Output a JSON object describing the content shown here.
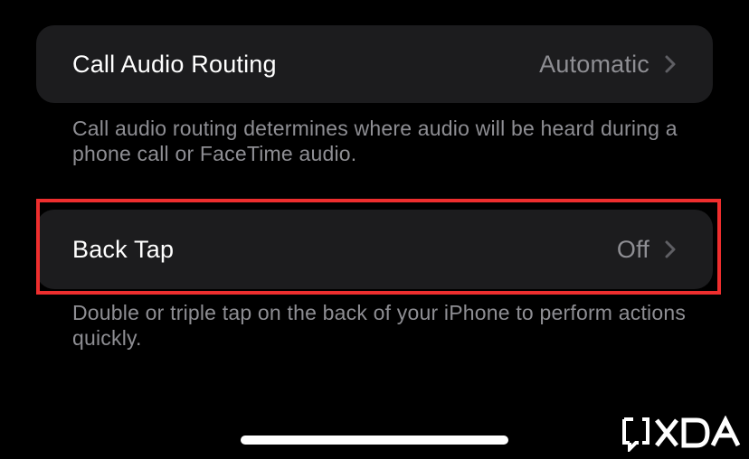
{
  "settings": {
    "call_audio_routing": {
      "label": "Call Audio Routing",
      "value": "Automatic",
      "footer": "Call audio routing determines where audio will be heard during a phone call or FaceTime audio."
    },
    "back_tap": {
      "label": "Back Tap",
      "value": "Off",
      "footer": "Double or triple tap on the back of your iPhone to perform actions quickly."
    }
  },
  "icons": {
    "chevron": "chevron-right-icon"
  },
  "watermark": {
    "text": "XDA"
  },
  "colors": {
    "background": "#000000",
    "cell": "#1c1c1e",
    "secondary_text": "#8e8e93",
    "highlight": "#ee2e2e"
  }
}
